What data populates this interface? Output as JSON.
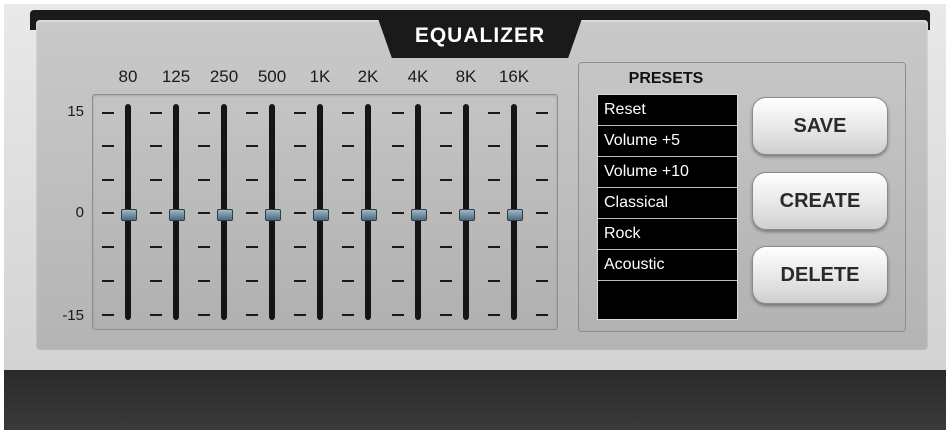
{
  "title": "EQUALIZER",
  "equalizer": {
    "scale": {
      "top": "15",
      "mid": "0",
      "bottom": "-15"
    },
    "bands": [
      {
        "label": "80",
        "gain": 0
      },
      {
        "label": "125",
        "gain": 0
      },
      {
        "label": "250",
        "gain": 0
      },
      {
        "label": "500",
        "gain": 0
      },
      {
        "label": "1K",
        "gain": 0
      },
      {
        "label": "2K",
        "gain": 0
      },
      {
        "label": "4K",
        "gain": 0
      },
      {
        "label": "8K",
        "gain": 0
      },
      {
        "label": "16K",
        "gain": 0
      }
    ]
  },
  "presets": {
    "title": "PRESETS",
    "items": [
      "Reset",
      "Volume +5",
      "Volume +10",
      "Classical",
      "Rock",
      "Acoustic"
    ]
  },
  "buttons": {
    "save": "SAVE",
    "create": "CREATE",
    "delete": "DELETE"
  },
  "colors": {
    "frame": "#1a1a1a",
    "list_bg": "#000000",
    "knob": "#6f8a9c"
  }
}
